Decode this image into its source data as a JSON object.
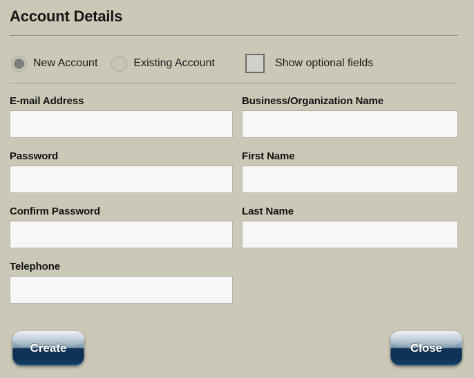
{
  "dialog": {
    "title": "Account Details"
  },
  "account_type": {
    "options": [
      {
        "label": "New Account",
        "selected": true
      },
      {
        "label": "Existing Account",
        "selected": false
      }
    ]
  },
  "optional_fields": {
    "label": "Show optional fields",
    "checked": false
  },
  "form": {
    "left_column": [
      {
        "label": "E-mail Address",
        "value": "",
        "placeholder": ""
      },
      {
        "label": "Password",
        "value": "",
        "placeholder": ""
      },
      {
        "label": "Confirm Password",
        "value": "",
        "placeholder": ""
      },
      {
        "label": "Telephone",
        "value": "",
        "placeholder": ""
      }
    ],
    "right_column": [
      {
        "label": "Business/Organization Name",
        "value": "",
        "placeholder": ""
      },
      {
        "label": "First Name",
        "value": "",
        "placeholder": ""
      },
      {
        "label": "Last Name",
        "value": "",
        "placeholder": ""
      }
    ]
  },
  "buttons": {
    "create": "Create",
    "close": "Close"
  },
  "colors": {
    "background": "#cbc8b8",
    "input_background": "#f7f7f7",
    "input_border": "#b3b2ae",
    "divider": "#8e8d84",
    "label_text": "#121212",
    "radio_fill": "#7e7e7e",
    "checkbox_fill": "#d1d0cc",
    "checkbox_border": "#6b6b6b",
    "button_top": "#c2d2dc",
    "button_bottom": "#0d2f51",
    "button_text": "#ffffff"
  }
}
